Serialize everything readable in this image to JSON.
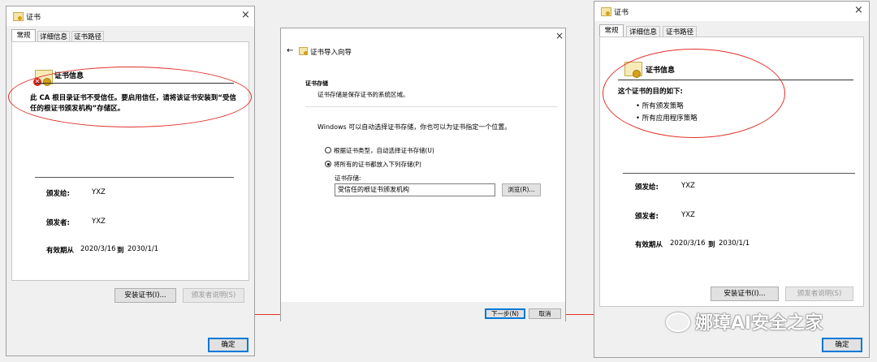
{
  "left_dialog": {
    "title": "证书",
    "close": "×",
    "tabs": [
      "常规",
      "详细信息",
      "证书路径"
    ],
    "heading": "证书信息",
    "warning_line1": "此 CA 根目录证书不受信任。要启用信任，请将该证书安装到“受信",
    "warning_line2": "任的根证书颁发机构”存储区。",
    "issued_to_label": "颁发给:",
    "issued_to_value": "YXZ",
    "issued_by_label": "颁发者:",
    "issued_by_value": "YXZ",
    "validity_label": "有效期从",
    "validity_from": "2020/3/16",
    "validity_to_word": "到",
    "validity_to": "2030/1/1",
    "install_button": "安装证书(I)...",
    "issuer_statement_button": "颁发者说明(S)",
    "ok_button": "确定"
  },
  "wizard": {
    "back": "←",
    "title": "证书导入向导",
    "close": "×",
    "section_title": "证书存储",
    "section_desc": "证书存储是保存证书的系统区域。",
    "intro": "Windows 可以自动选择证书存储，你也可以为证书指定一个位置。",
    "option_auto": "根据证书类型，自动选择证书存储(U)",
    "option_manual": "将所有的证书都放入下列存储(P)",
    "store_label": "证书存储:",
    "store_value": "受信任的根证书颁发机构",
    "browse_button": "浏览(R)...",
    "next_button": "下一步(N)",
    "cancel_button": "取消"
  },
  "right_dialog": {
    "title": "证书",
    "close": "×",
    "tabs": [
      "常规",
      "详细信息",
      "证书路径"
    ],
    "heading": "证书信息",
    "purpose_title": "这个证书的目的如下:",
    "purposes": [
      "• 所有颁发策略",
      "• 所有应用程序策略"
    ],
    "issued_to_label": "颁发给:",
    "issued_to_value": "YXZ",
    "issued_by_label": "颁发者:",
    "issued_by_value": "YXZ",
    "validity_label": "有效期从",
    "validity_from": "2020/3/16",
    "validity_to_word": "到",
    "validity_to": "2030/1/1",
    "install_button": "安装证书(I)...",
    "issuer_statement_button": "颁发者说明(S)",
    "ok_button": "确定"
  },
  "watermark": "娜璋AI安全之家",
  "colors": {
    "annotation": "#e0322a",
    "accent": "#0078d7"
  }
}
